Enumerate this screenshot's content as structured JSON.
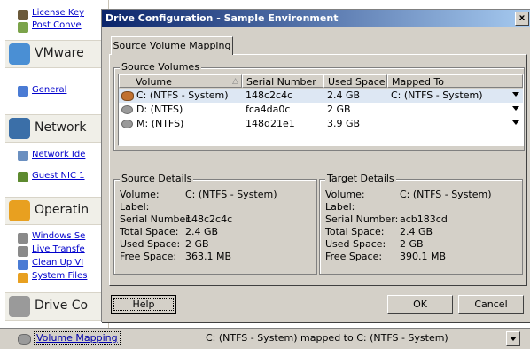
{
  "sidebar": {
    "links_top": [
      "License Key",
      "Post Conve"
    ],
    "vmware_section": "VMware",
    "link_general": "General",
    "network_section": "Network",
    "link_network_id": "Network Ide",
    "link_guest_nic": "Guest NIC 1",
    "operating_section": "Operatin",
    "os_links": [
      "Windows Se",
      "Live Transfe",
      "Clean Up VI",
      "System Files"
    ],
    "drive_section": "Drive Co"
  },
  "dialog": {
    "title": "Drive Configuration - Sample Environment",
    "close_glyph": "x",
    "tab_label": "Source Volume Mapping",
    "source_volumes": {
      "legend": "Source Volumes",
      "columns": [
        "Volume",
        "Serial Number",
        "Used Space",
        "Mapped To"
      ],
      "rows": [
        {
          "volume": "C: (NTFS - System)",
          "serial": "148c2c4c",
          "used": "2.4 GB",
          "mapped": "C: (NTFS - System)"
        },
        {
          "volume": "D: (NTFS)",
          "serial": "fca4da0c",
          "used": "2 GB",
          "mapped": ""
        },
        {
          "volume": "M: (NTFS)",
          "serial": "148d21e1",
          "used": "3.9 GB",
          "mapped": ""
        }
      ]
    },
    "source_details": {
      "legend": "Source Details",
      "labels": [
        "Volume:",
        "Label:",
        "Serial Number:",
        "Total Space:",
        "Used Space:",
        "Free Space:"
      ],
      "values": [
        "C: (NTFS - System)",
        "",
        "148c2c4c",
        "2.4 GB",
        "2 GB",
        "363.1 MB"
      ]
    },
    "target_details": {
      "legend": "Target Details",
      "labels": [
        "Volume:",
        "Label:",
        "Serial Number:",
        "Total Space:",
        "Used Space:",
        "Free Space:"
      ],
      "values": [
        "C: (NTFS - System)",
        "",
        "acb183cd",
        "2.4 GB",
        "2 GB",
        "390.1 MB"
      ]
    },
    "buttons": {
      "help": "Help",
      "ok": "OK",
      "cancel": "Cancel"
    }
  },
  "bottom": {
    "link": "Volume Mapping",
    "text": "C: (NTFS - System) mapped to C: (NTFS - System)"
  },
  "colors": {
    "title_start": "#0a246a",
    "title_end": "#a6caf0",
    "selection": "#dde7f3",
    "face": "#d4d0c8"
  }
}
